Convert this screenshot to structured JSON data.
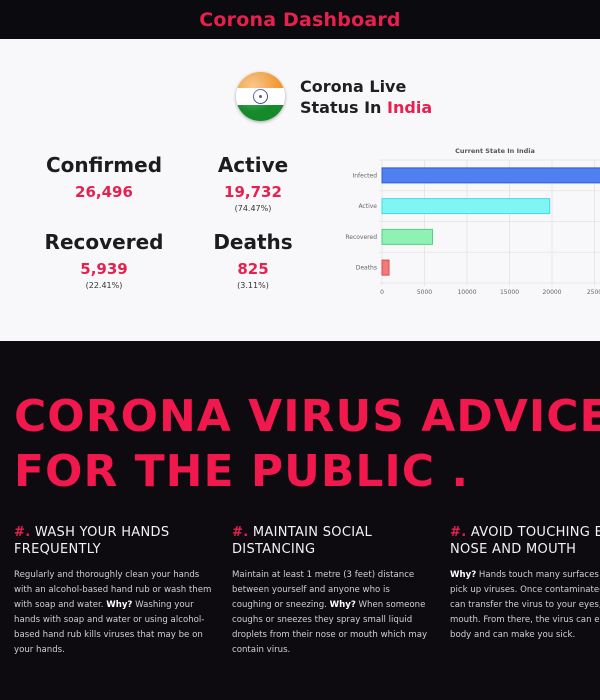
{
  "header": {
    "title": "Corona Dashboard"
  },
  "status": {
    "line1": "Corona Live",
    "line2_prefix": "Status In",
    "country": "India"
  },
  "stats": [
    {
      "label": "Confirmed",
      "value": "26,496",
      "pct": ""
    },
    {
      "label": "Active",
      "value": "19,732",
      "pct": "(74.47%)"
    },
    {
      "label": "Recovered",
      "value": "5,939",
      "pct": "(22.41%)"
    },
    {
      "label": "Deaths",
      "value": "825",
      "pct": "(3.11%)"
    }
  ],
  "chart_data": {
    "type": "bar",
    "orientation": "horizontal",
    "title": "Current State In India",
    "categories": [
      "Infected",
      "Active",
      "Recovered",
      "Deaths"
    ],
    "values": [
      26496,
      19732,
      5939,
      825
    ],
    "colors": [
      "#4f7ff0",
      "#7ff5f5",
      "#8ff2b4",
      "#f27a7a"
    ],
    "borders": [
      "#2f5fd8",
      "#45d8e0",
      "#52cf84",
      "#e14747"
    ],
    "xlim": [
      0,
      25000
    ],
    "xticks": [
      "0",
      "5000",
      "10000",
      "15000",
      "20000",
      "2500"
    ],
    "grid": true,
    "legend": "none"
  },
  "hero": {
    "line1": "CORONA VIRUS ADVICE",
    "line2": "FOR THE PUBLIC ."
  },
  "advice": [
    {
      "hash": "#.",
      "title": "WASH YOUR HANDS FREQUENTLY",
      "body": [
        {
          "text": "Regularly and thoroughly clean your hands with an alcohol-based hand rub or wash them with soap and water. ",
          "bold": false
        },
        {
          "text": "Why?",
          "bold": true
        },
        {
          "text": " Washing your hands with soap and water or using alcohol-based hand rub kills viruses that may be on your hands.",
          "bold": false
        }
      ]
    },
    {
      "hash": "#.",
      "title": "MAINTAIN SOCIAL DISTANCING",
      "body": [
        {
          "text": "Maintain at least 1 metre (3 feet) distance between yourself and anyone who is coughing or sneezing. ",
          "bold": false
        },
        {
          "text": "Why?",
          "bold": true
        },
        {
          "text": " When someone coughs or sneezes they spray small liquid droplets from their nose or mouth which may contain virus.",
          "bold": false
        }
      ]
    },
    {
      "hash": "#.",
      "title": "AVOID TOUCHING EYES, NOSE AND MOUTH",
      "body": [
        {
          "text": "Why?",
          "bold": true
        },
        {
          "text": " Hands touch many surfaces and can pick up viruses. Once contaminated, hands can transfer the virus to your eyes, nose or mouth. From there, the virus can enter your body and can make you sick.",
          "bold": false
        }
      ]
    }
  ]
}
